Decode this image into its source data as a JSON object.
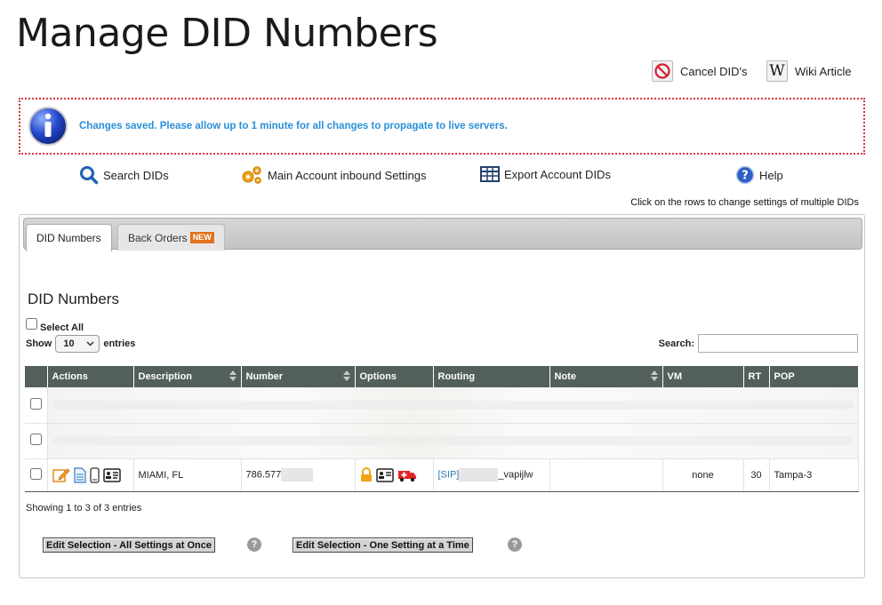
{
  "page": {
    "title": "Manage DID Numbers"
  },
  "top_actions": {
    "cancel_label": "Cancel DID's",
    "wiki_label": "Wiki Article"
  },
  "notice": {
    "text": "Changes saved. Please allow up to 1 minute for all changes to propagate to live servers."
  },
  "nav": {
    "search_dids": "Search DIDs",
    "main_inbound": "Main Account inbound Settings",
    "export_dids": "Export Account DIDs",
    "help": "Help"
  },
  "hint": "Click on the rows to change settings of multiple DIDs",
  "tabs": [
    {
      "label": "DID Numbers",
      "active": true
    },
    {
      "label": "Back Orders",
      "badge": "NEW",
      "active": false
    }
  ],
  "section_title": "DID Numbers",
  "controls": {
    "select_all_label": "Select All",
    "show_label": "Show",
    "page_size": "10",
    "entries_label": "entries",
    "search_label": "Search:"
  },
  "table": {
    "columns": [
      "Actions",
      "Description",
      "Number",
      "Options",
      "Routing",
      "Note",
      "VM",
      "RT",
      "POP"
    ],
    "rows": [
      {
        "description": "MIAMI, FL",
        "number_prefix": "786.577",
        "routing_prefix": "[SIP]",
        "routing_suffix": "_vapijlw",
        "note": "",
        "vm": "none",
        "rt": "30",
        "pop": "Tampa-3"
      }
    ]
  },
  "footer": {
    "info": "Showing 1 to 3 of 3 entries",
    "edit_all": "Edit Selection - All Settings at Once",
    "edit_one": "Edit Selection - One Setting at a Time",
    "help_glyph": "?"
  },
  "colors": {
    "accent_blue": "#2a8fd9",
    "notice_border": "#d9363e",
    "table_header": "#525f5a",
    "new_badge": "#e2711d"
  }
}
